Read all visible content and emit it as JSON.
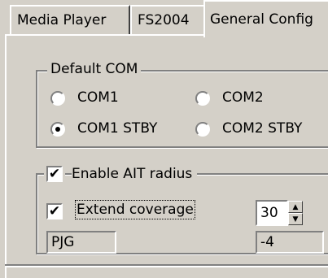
{
  "tabs": [
    {
      "label": "Media Player"
    },
    {
      "label": "FS2004"
    },
    {
      "label": "General Config"
    }
  ],
  "default_com": {
    "title": "Default COM",
    "options": [
      {
        "label": "COM1",
        "selected": false
      },
      {
        "label": "COM2",
        "selected": false
      },
      {
        "label": "COM1 STBY",
        "selected": true
      },
      {
        "label": "COM2 STBY",
        "selected": false
      }
    ]
  },
  "ait": {
    "enable_label": "Enable AIT radius",
    "enable_checked": true,
    "extend_label": "Extend coverage",
    "extend_checked": true,
    "radius_value": "30",
    "code_value": "PJG",
    "offset_value": "-4"
  },
  "icons": {
    "check": "checkmark-icon",
    "spin_up": "spin-up-icon",
    "spin_down": "spin-down-icon"
  }
}
